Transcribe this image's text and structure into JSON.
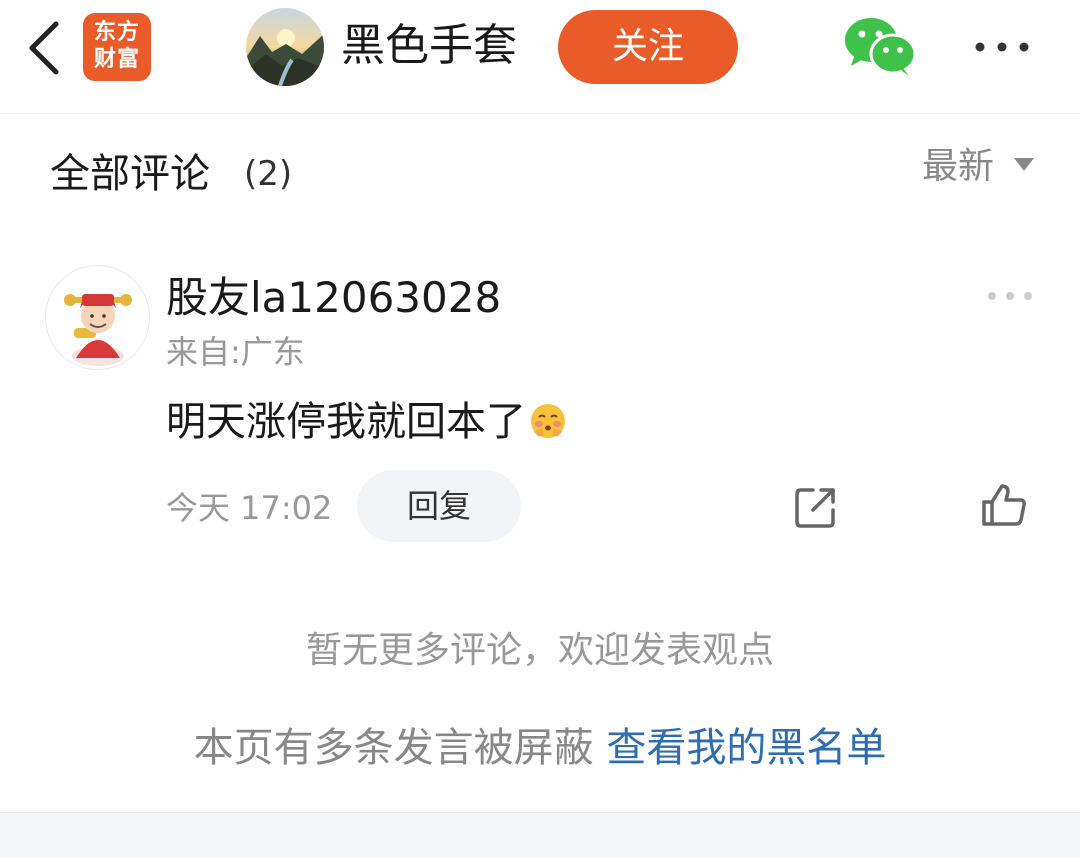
{
  "header": {
    "logo_line1": "东方",
    "logo_line2": "财富",
    "channel_name": "黑色手套",
    "follow_label": "关注",
    "icons": [
      "back-arrow-icon",
      "wechat-icon",
      "more-icon"
    ],
    "accent_color": "#ea5b2a"
  },
  "comments_section": {
    "title": "全部评论",
    "count": "(2)",
    "sort_label": "最新"
  },
  "comment": {
    "username": "股友la12063028",
    "location": "来自:广东",
    "text": "明天涨停我就回本了",
    "emoji": "blushing-face-emoji",
    "time": "今天 17:02",
    "reply_label": "回复",
    "icons": [
      "share-icon",
      "thumbs-up-icon",
      "more-dots-icon"
    ]
  },
  "footer": {
    "no_more": "暂无更多评论，欢迎发表观点",
    "blocked_text": "本页有多条发言被屏蔽 ",
    "blacklist_link": "查看我的黑名单",
    "link_color": "#2f6db3"
  }
}
